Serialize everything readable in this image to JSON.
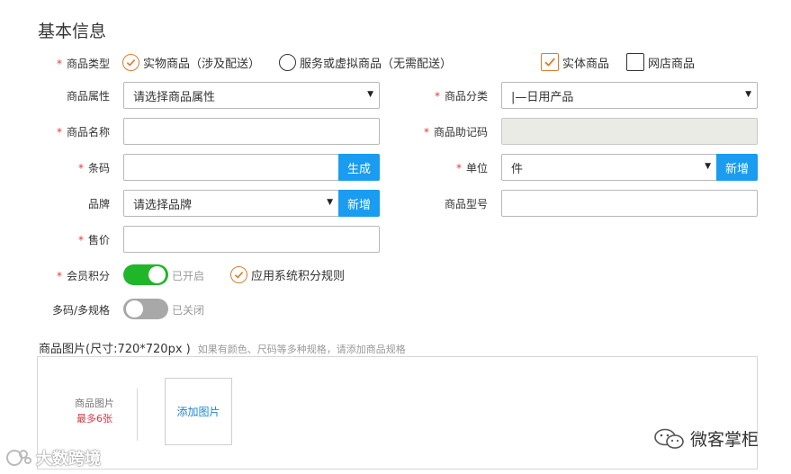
{
  "section": {
    "title": "基本信息"
  },
  "goods_type": {
    "label": "商品类型",
    "options": [
      {
        "label": "实物商品（涉及配送）",
        "selected": true
      },
      {
        "label": "服务或虚拟商品（无需配送）",
        "selected": false
      }
    ],
    "checkboxes": [
      {
        "label": "实体商品",
        "checked": true
      },
      {
        "label": "网店商品",
        "checked": false
      }
    ]
  },
  "attribute": {
    "label": "商品属性",
    "value": "请选择商品属性"
  },
  "category": {
    "label": "商品分类",
    "value": "|—日用产品"
  },
  "name": {
    "label": "商品名称",
    "value": ""
  },
  "mnemonic": {
    "label": "商品助记码",
    "value": ""
  },
  "barcode": {
    "label": "条码",
    "value": "",
    "button": "生成"
  },
  "unit": {
    "label": "单位",
    "value": "件",
    "button": "新增"
  },
  "brand": {
    "label": "品牌",
    "value": "请选择品牌",
    "button": "新增"
  },
  "model": {
    "label": "商品型号",
    "value": ""
  },
  "price": {
    "label": "售价",
    "value": ""
  },
  "points": {
    "label": "会员积分",
    "toggle_on": true,
    "toggle_text": "已开启",
    "rule_label": "应用系统积分规则",
    "rule_checked": true
  },
  "multi_spec": {
    "label": "多码/多规格",
    "toggle_on": false,
    "toggle_text": "已关闭"
  },
  "images": {
    "title": "商品图片(尺寸:720*720px )",
    "hint": "如果有颜色、尺码等多种规格，请添加商品规格",
    "info_label": "商品图片",
    "info_max": "最多6张",
    "add_label": "添加图片"
  },
  "watermark": {
    "left": "大数跨境",
    "right": "微客掌柜"
  },
  "colors": {
    "accent": "#e07b2a",
    "button": "#1a9cf0",
    "toggle_on": "#21b52a",
    "toggle_off": "#a8a8a8",
    "required": "#e4393c"
  }
}
